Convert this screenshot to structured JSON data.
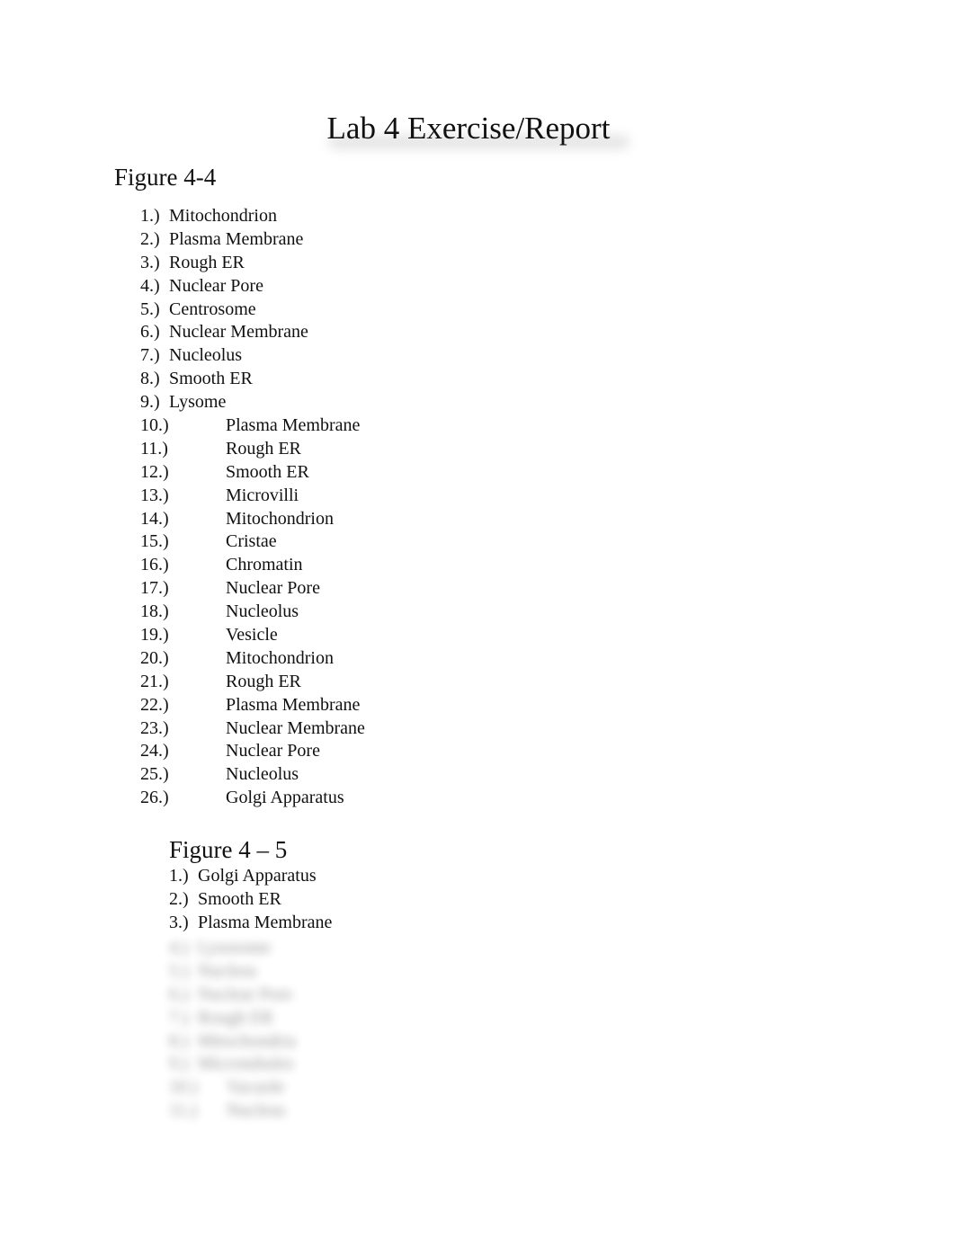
{
  "document": {
    "title": "Lab 4 Exercise/Report",
    "figure_4_4": {
      "heading": "Figure 4-4",
      "items": [
        {
          "num": "1.)",
          "label": "Mitochondrion"
        },
        {
          "num": "2.)",
          "label": "Plasma Membrane"
        },
        {
          "num": "3.)",
          "label": "Rough ER"
        },
        {
          "num": "4.)",
          "label": "Nuclear Pore"
        },
        {
          "num": "5.)",
          "label": "Centrosome"
        },
        {
          "num": "6.)",
          "label": "Nuclear Membrane"
        },
        {
          "num": "7.)",
          "label": "Nucleolus"
        },
        {
          "num": "8.)",
          "label": "Smooth ER"
        },
        {
          "num": "9.)",
          "label": "Lysome"
        },
        {
          "num": "10.)",
          "label": "Plasma Membrane"
        },
        {
          "num": "11.)",
          "label": "Rough ER"
        },
        {
          "num": "12.)",
          "label": "Smooth ER"
        },
        {
          "num": "13.)",
          "label": "Microvilli"
        },
        {
          "num": "14.)",
          "label": "Mitochondrion"
        },
        {
          "num": "15.)",
          "label": "Cristae"
        },
        {
          "num": "16.)",
          "label": "Chromatin"
        },
        {
          "num": "17.)",
          "label": "Nuclear Pore"
        },
        {
          "num": "18.)",
          "label": "Nucleolus"
        },
        {
          "num": "19.)",
          "label": "Vesicle"
        },
        {
          "num": "20.)",
          "label": "Mitochondrion"
        },
        {
          "num": "21.)",
          "label": "Rough ER"
        },
        {
          "num": "22.)",
          "label": "Plasma Membrane"
        },
        {
          "num": "23.)",
          "label": "Nuclear Membrane"
        },
        {
          "num": "24.)",
          "label": "Nuclear Pore"
        },
        {
          "num": "25.)",
          "label": "Nucleolus"
        },
        {
          "num": "26.)",
          "label": "Golgi Apparatus"
        }
      ]
    },
    "figure_4_5": {
      "heading": "Figure 4 – 5",
      "items": [
        {
          "num": "1.)",
          "label": "Golgi Apparatus"
        },
        {
          "num": "2.)",
          "label": "Smooth ER"
        },
        {
          "num": "3.)",
          "label": "Plasma Membrane"
        }
      ],
      "blurred_items": [
        {
          "num": "4.)",
          "label": "Lysosome"
        },
        {
          "num": "5.)",
          "label": "Nucleus"
        },
        {
          "num": "6.)",
          "label": "Nuclear Pore"
        },
        {
          "num": "7.)",
          "label": "Rough ER"
        },
        {
          "num": "8.)",
          "label": "Mitochondria"
        },
        {
          "num": "9.)",
          "label": "Microtubules"
        },
        {
          "num": "10.)",
          "label": "Vacuole"
        },
        {
          "num": "11.)",
          "label": "Nucleus"
        }
      ]
    }
  }
}
